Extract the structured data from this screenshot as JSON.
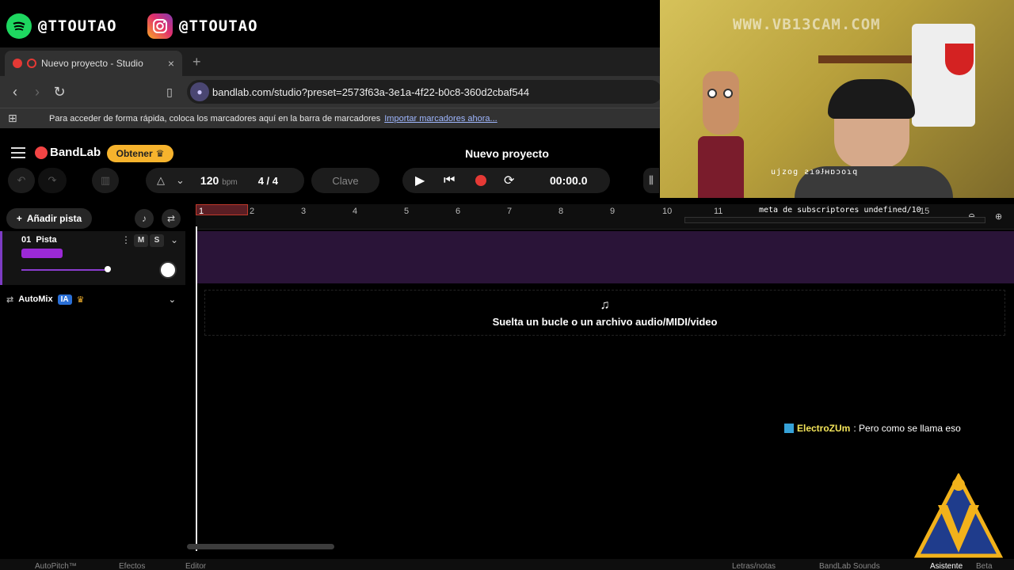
{
  "overlay": {
    "spotify_handle": "@TTOUTAO",
    "instagram_handle": "@TTOUTAO",
    "watermark": "WWW.VB13CAM.COM",
    "webcam_caption": "ujzog ƨıɘɈʜɒɔoɿq",
    "sub_goal": "meta de subscriptores undefined/10",
    "chat_user": "ElectroZUm",
    "chat_message": ": Pero como se llama eso"
  },
  "browser": {
    "tab_title": "Nuevo proyecto - Studio",
    "tab_close": "×",
    "new_tab": "+",
    "url": "bandlab.com/studio?preset=2573f63a-3e1a-4f22-b0c8-360d2cbaf544",
    "bookmarks_text": "Para acceder de forma rápida, coloca los marcadores aquí en la barra de marcadores",
    "bookmarks_link": "Importar marcadores ahora..."
  },
  "bandlab": {
    "logo": "BandLab",
    "obtener": "Obtener",
    "project_title": "Nuevo proyecto",
    "bpm_value": "120",
    "bpm_unit": "bpm",
    "time_signature": "4 / 4",
    "key": "Clave",
    "time": "00:00.0",
    "add_track": "Añadir pista",
    "track_number": "01",
    "track_name": "Pista",
    "mute": "M",
    "solo": "S",
    "automix": "AutoMix",
    "ia_badge": "IA",
    "drop_text": "Suelta un bucle o un archivo audio/MIDI/video",
    "ruler": [
      "1",
      "2",
      "3",
      "4",
      "5",
      "6",
      "7",
      "8",
      "9",
      "10",
      "11",
      "15"
    ],
    "bottom": {
      "autopitch": "AutoPitch™",
      "effects": "Efectos",
      "editor": "Editor",
      "lyrics": "Letras/notas",
      "sounds": "BandLab Sounds",
      "assistant": "Asistente",
      "beta": "Beta"
    }
  },
  "colors": {
    "accent_purple": "#7d3cc4",
    "record_red": "#e53935",
    "obtener_yellow": "#f6b32d"
  }
}
